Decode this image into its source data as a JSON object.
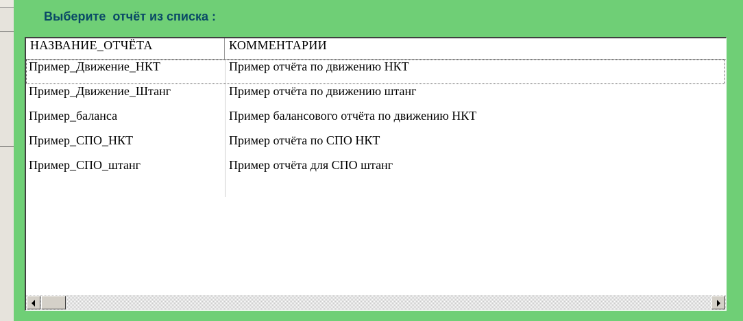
{
  "dialog": {
    "title": "Выберите  отчёт из списка :"
  },
  "table": {
    "columns": [
      "НАЗВАНИЕ_ОТЧЁТА",
      "КОММЕНТАРИИ"
    ],
    "rows": [
      {
        "name": "Пример_Движение_НКТ",
        "comment": "Пример отчёта по движению НКТ"
      },
      {
        "name": "Пример_Движение_Штанг",
        "comment": "Пример отчёта по движению штанг"
      },
      {
        "name": "Пример_баланса",
        "comment": "Пример балансового отчёта по движению НКТ"
      },
      {
        "name": "Пример_СПО_НКТ",
        "comment": "Пример отчёта по СПО НКТ"
      },
      {
        "name": "Пример_СПО_штанг",
        "comment": "Пример отчёта для СПО штанг"
      }
    ],
    "selected_row": 0
  },
  "scrollbar": {
    "left_icon": "arrow-left-icon",
    "right_icon": "arrow-right-icon"
  }
}
